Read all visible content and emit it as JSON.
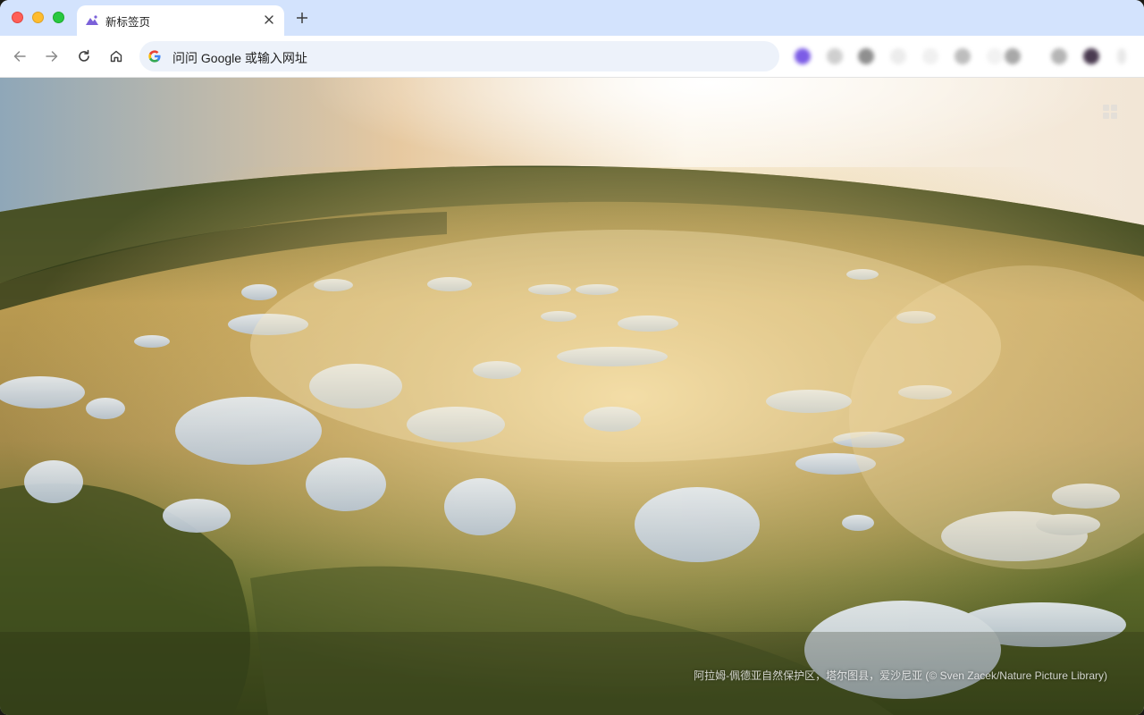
{
  "window": {
    "traffic_lights": [
      "close",
      "minimize",
      "zoom"
    ]
  },
  "tab": {
    "title": "新标签页",
    "favicon": "mountain-icon",
    "close_icon": "close-icon"
  },
  "toolbar": {
    "back_icon": "back-arrow-icon",
    "forward_icon": "forward-arrow-icon",
    "reload_icon": "reload-icon",
    "home_icon": "home-icon",
    "omnibox_icon": "google-g-icon",
    "omnibox_placeholder": "问问 Google 或输入网址",
    "extensions_blurred": true
  },
  "colors": {
    "tabstrip": "#d3e3fd",
    "omnibox": "#edf2fa",
    "accent": "#4285f4"
  },
  "background": {
    "description_credit": "阿拉姆-佩德亚自然保护区，塔尔图县，爱沙尼亚 (© Sven Zacek/Nature Picture Library)"
  }
}
